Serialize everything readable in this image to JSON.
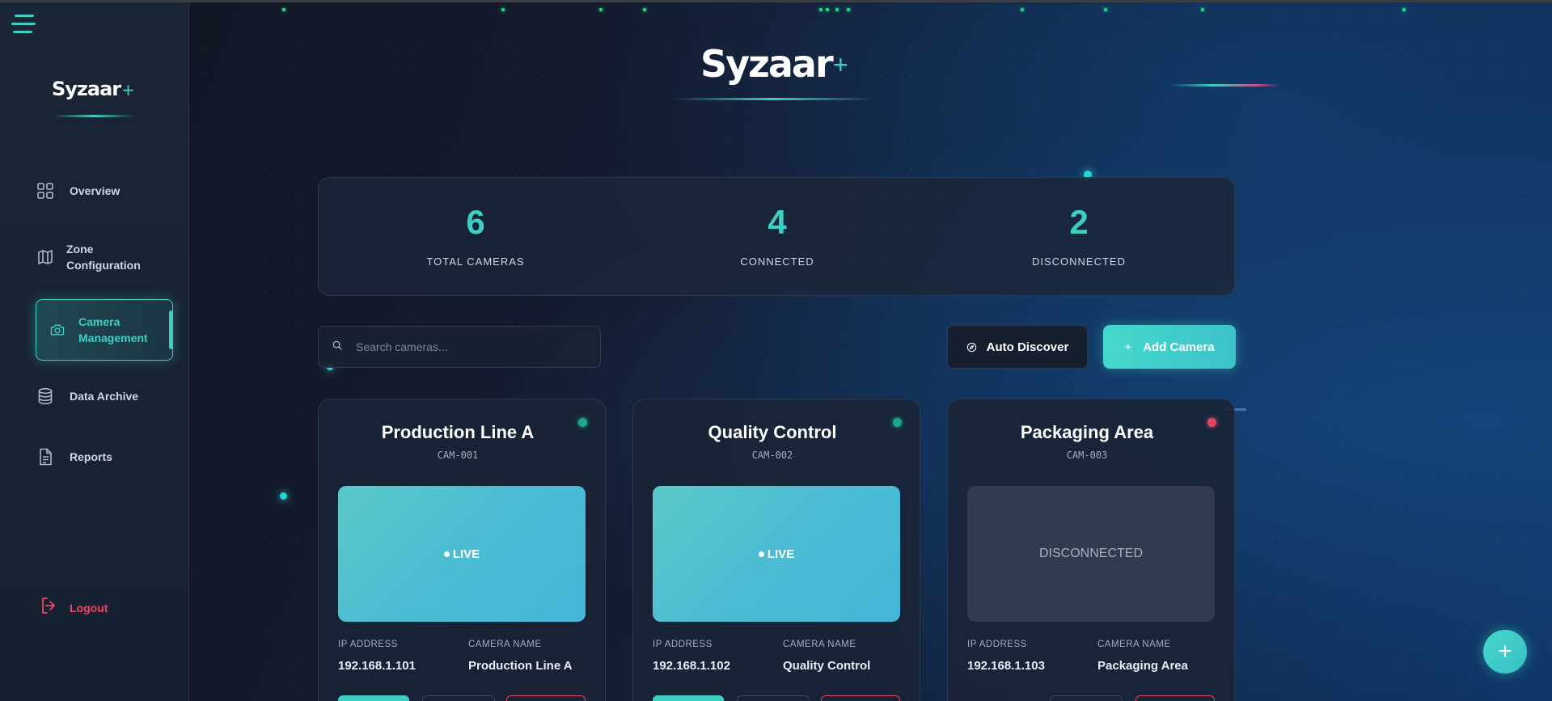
{
  "sidebar": {
    "logo": "Syzaar",
    "logo_plus": "+",
    "items": [
      {
        "label": "Overview",
        "icon": "grid-icon"
      },
      {
        "label": "Zone Configuration",
        "icon": "map-icon"
      },
      {
        "label": "Camera Management",
        "icon": "camera-icon",
        "active": true
      },
      {
        "label": "Data Archive",
        "icon": "database-icon"
      },
      {
        "label": "Reports",
        "icon": "file-text-icon"
      }
    ],
    "logout": "Logout"
  },
  "header": {
    "logo": "Syzaar",
    "logo_plus": "+"
  },
  "stats": [
    {
      "value": "6",
      "label": "TOTAL CAMERAS"
    },
    {
      "value": "4",
      "label": "CONNECTED"
    },
    {
      "value": "2",
      "label": "DISCONNECTED"
    }
  ],
  "toolbar": {
    "search_placeholder": "Search cameras...",
    "auto_discover_label": "Auto Discover",
    "add_camera_label": "Add Camera"
  },
  "cameras": [
    {
      "title": "Production Line A",
      "id": "CAM-001",
      "status": "connected",
      "preview": "LIVE",
      "ip_label": "IP ADDRESS",
      "ip": "192.168.1.101",
      "name_label": "CAMERA NAME",
      "name": "Production Line A"
    },
    {
      "title": "Quality Control",
      "id": "CAM-002",
      "status": "connected",
      "preview": "LIVE",
      "ip_label": "IP ADDRESS",
      "ip": "192.168.1.102",
      "name_label": "CAMERA NAME",
      "name": "Quality Control"
    },
    {
      "title": "Packaging Area",
      "id": "CAM-003",
      "status": "disconnected",
      "preview": "DISCONNECTED",
      "ip_label": "IP ADDRESS",
      "ip": "192.168.1.103",
      "name_label": "CAMERA NAME",
      "name": "Packaging Area"
    }
  ],
  "fab_label": "+",
  "colors": {
    "accent": "#3ecfc4",
    "connected": "#1aa889",
    "disconnected": "#e0485f",
    "logout": "#ef4565"
  }
}
